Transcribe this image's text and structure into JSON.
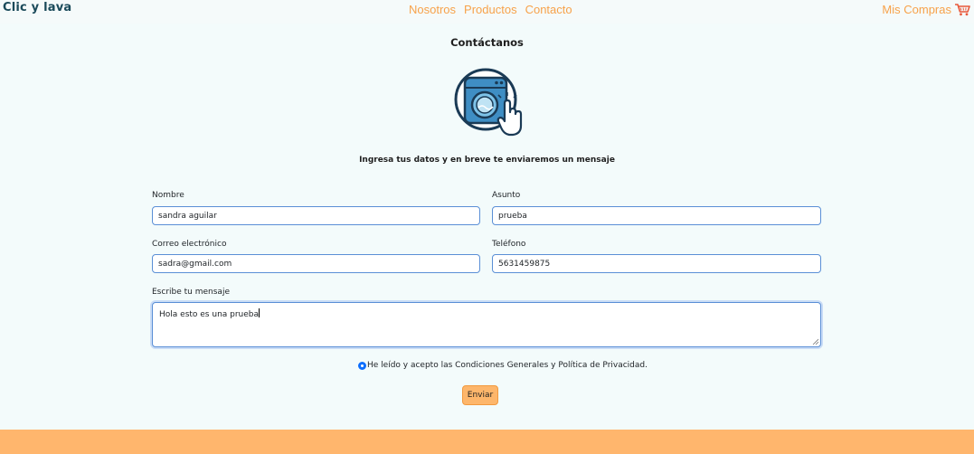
{
  "navbar": {
    "brand": "Clic y lava",
    "links": [
      "Nosotros",
      "Productos",
      "Contacto"
    ],
    "cart_label": "Mis Compras",
    "cart_icon": "shopping-cart-icon",
    "accent_color": "#f7a24a"
  },
  "main": {
    "title": "Contáctanos",
    "logo_icon": "washing-machine-click-icon",
    "subtitle": "Ingresa tus datos y en breve te enviaremos un mensaje"
  },
  "form": {
    "name_label": "Nombre",
    "name_value": "sandra aguilar",
    "subject_label": "Asunto",
    "subject_value": "prueba",
    "email_label": "Correo electrónico",
    "email_value": "sadra@gmail.com",
    "phone_label": "Teléfono",
    "phone_value": "5631459875",
    "message_label": "Escribe tu mensaje",
    "message_value": "Hola esto es una prueba",
    "consent_text": "He leído y acepto las Condiciones Generales y Política de Privacidad.",
    "consent_checked": true,
    "submit_label": "Enviar"
  },
  "footer": {
    "color": "#ffb66d"
  }
}
